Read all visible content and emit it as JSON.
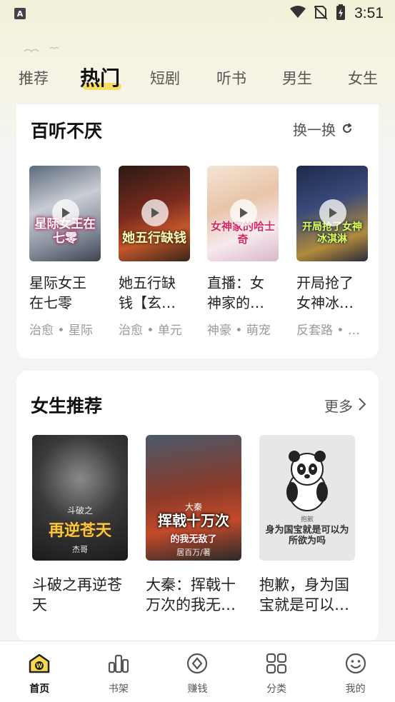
{
  "status_bar": {
    "time": "3:51",
    "notif": "A"
  },
  "tabs": [
    "推荐",
    "热门",
    "短剧",
    "听书",
    "男生",
    "女生"
  ],
  "active_tab": "热门",
  "section1": {
    "title": "百听不厌",
    "action": "换一换",
    "books": [
      {
        "title": "星际女王在七零",
        "display_title": "星际女王\n在七零",
        "tags": "治愈 • 星际",
        "cover_text": "星际女王在七零"
      },
      {
        "title": "她五行缺钱【玄学】",
        "display_title": "她五行缺\n钱【玄…",
        "tags": "治愈 • 单元",
        "cover_text": "她五行缺钱"
      },
      {
        "title": "直播：女神家的哈士奇",
        "display_title": "直播：女\n神家的…",
        "tags": "神豪 • 萌宠",
        "cover_text": "女神家的哈士奇"
      },
      {
        "title": "开局抢了女神冰淇淋",
        "display_title": "开局抢了\n女神冰…",
        "tags": "反套路 • …",
        "cover_text": "开局抢了女神冰淇淋"
      }
    ]
  },
  "section2": {
    "title": "女生推荐",
    "action": "更多",
    "books": [
      {
        "display_title": "斗破之再逆苍\n天",
        "cover_text": "再逆苍天",
        "cover_top": "斗破之",
        "cover_author": "杰哥"
      },
      {
        "display_title": "大秦：挥戟十\n万次的我无…",
        "cover_text": "挥戟十万次",
        "cover_top": "大秦",
        "cover_bottom": "的我无敌了",
        "cover_author": "居百万/著"
      },
      {
        "display_title": "抱歉，身为国\n宝就是可以…",
        "cover_text": "身为国宝就是可以为所欲为吗",
        "cover_top": "抱歉"
      }
    ]
  },
  "bottom_nav": [
    {
      "label": "首页",
      "icon": "home-w-icon",
      "active": true
    },
    {
      "label": "书架",
      "icon": "bookshelf-icon",
      "active": false
    },
    {
      "label": "赚钱",
      "icon": "coin-icon",
      "active": false
    },
    {
      "label": "分类",
      "icon": "grid-icon",
      "active": false
    },
    {
      "label": "我的",
      "icon": "smile-icon",
      "active": false
    }
  ],
  "colors": {
    "accent": "#f7d94a",
    "background": "#f4f4f2",
    "card": "#ffffff"
  }
}
